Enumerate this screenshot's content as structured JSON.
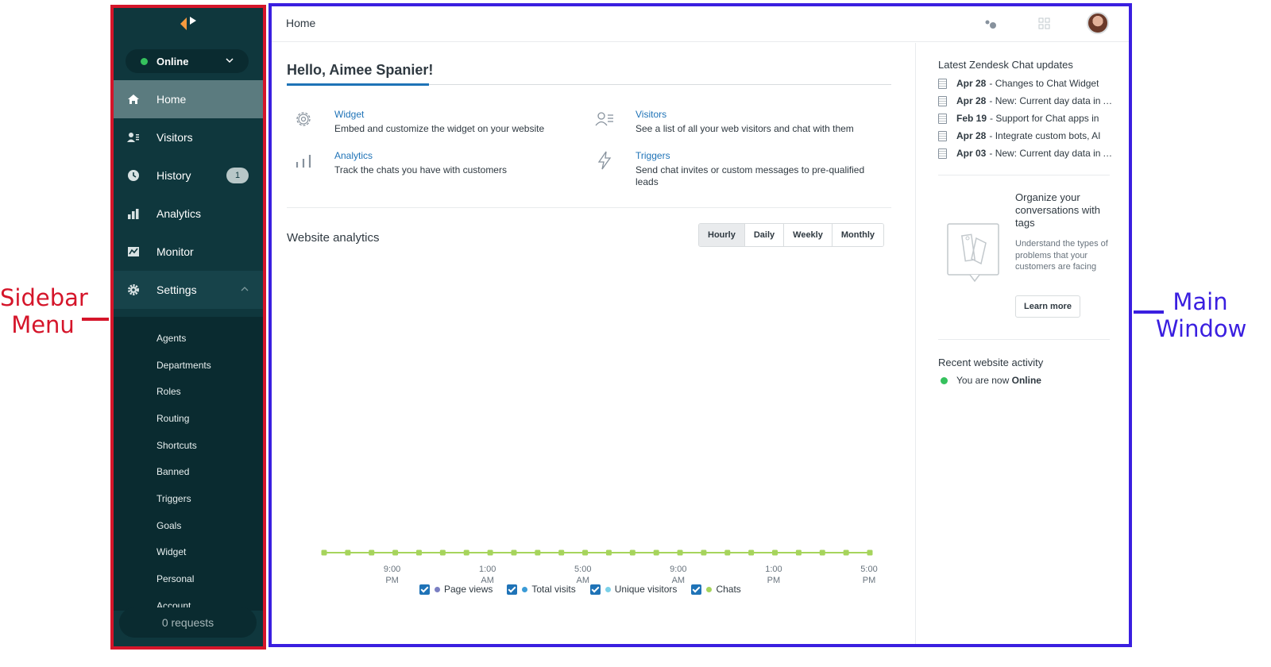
{
  "annotations": {
    "sidebar_label": "Sidebar Menu",
    "main_label": "Main Window"
  },
  "sidebar": {
    "status": "Online",
    "nav": [
      {
        "label": "Home",
        "icon": "home-icon"
      },
      {
        "label": "Visitors",
        "icon": "visitors-icon"
      },
      {
        "label": "History",
        "icon": "clock-icon",
        "badge": "1"
      },
      {
        "label": "Analytics",
        "icon": "bar-chart-icon"
      },
      {
        "label": "Monitor",
        "icon": "monitor-icon"
      },
      {
        "label": "Settings",
        "icon": "gear-icon"
      }
    ],
    "settings_items": [
      "Agents",
      "Departments",
      "Roles",
      "Routing",
      "Shortcuts",
      "Banned",
      "Triggers",
      "Goals",
      "Widget",
      "Personal",
      "Account"
    ],
    "requests": "0 requests"
  },
  "topbar": {
    "title": "Home"
  },
  "content": {
    "greeting": "Hello, Aimee Spanier!",
    "features": [
      {
        "title": "Widget",
        "desc": "Embed and customize the widget on your website",
        "icon": "gear-icon"
      },
      {
        "title": "Visitors",
        "desc": "See a list of all your web visitors and chat with them",
        "icon": "visitors-list-icon"
      },
      {
        "title": "Analytics",
        "desc": "Track the chats you have with customers",
        "icon": "bar-chart-icon"
      },
      {
        "title": "Triggers",
        "desc": "Send chat invites or custom messages to pre-qualified leads",
        "icon": "lightning-icon"
      }
    ],
    "analytics": {
      "title": "Website analytics",
      "ranges": [
        "Hourly",
        "Daily",
        "Weekly",
        "Monthly"
      ],
      "selected_range": "Hourly",
      "legend": [
        {
          "label": "Page views",
          "color": "#7a7fc2"
        },
        {
          "label": "Total visits",
          "color": "#3b9bd6"
        },
        {
          "label": "Unique visitors",
          "color": "#7cd1e8"
        },
        {
          "label": "Chats",
          "color": "#a6d45c"
        }
      ]
    }
  },
  "chart_data": {
    "type": "line",
    "x_tick_labels": [
      [
        "9:00",
        "PM"
      ],
      [
        "1:00",
        "AM"
      ],
      [
        "5:00",
        "AM"
      ],
      [
        "9:00",
        "AM"
      ],
      [
        "1:00",
        "PM"
      ],
      [
        "5:00",
        "PM"
      ]
    ],
    "series": [
      {
        "name": "Chats",
        "color": "#a6d45c",
        "values": [
          0,
          0,
          0,
          0,
          0,
          0,
          0,
          0,
          0,
          0,
          0,
          0,
          0,
          0,
          0,
          0,
          0,
          0,
          0,
          0,
          0,
          0,
          0,
          0
        ]
      }
    ]
  },
  "right_panel": {
    "updates_title": "Latest Zendesk Chat updates",
    "updates": [
      {
        "date": "Apr 28",
        "text": "- Changes to Chat Widget"
      },
      {
        "date": "Apr 28",
        "text": "- New: Current day data in Analytics"
      },
      {
        "date": "Feb 19",
        "text": "- Support for Chat apps in"
      },
      {
        "date": "Apr 28",
        "text": "- Integrate custom bots, AI"
      },
      {
        "date": "Apr 03",
        "text": "- New: Current day data in Analytics"
      }
    ],
    "promo": {
      "heading": "Organize your conversations with tags",
      "text": "Understand the types of problems that your customers are facing",
      "button": "Learn more"
    },
    "activity_title": "Recent website activity",
    "activity_prefix": "You are now",
    "activity_status": "Online"
  }
}
